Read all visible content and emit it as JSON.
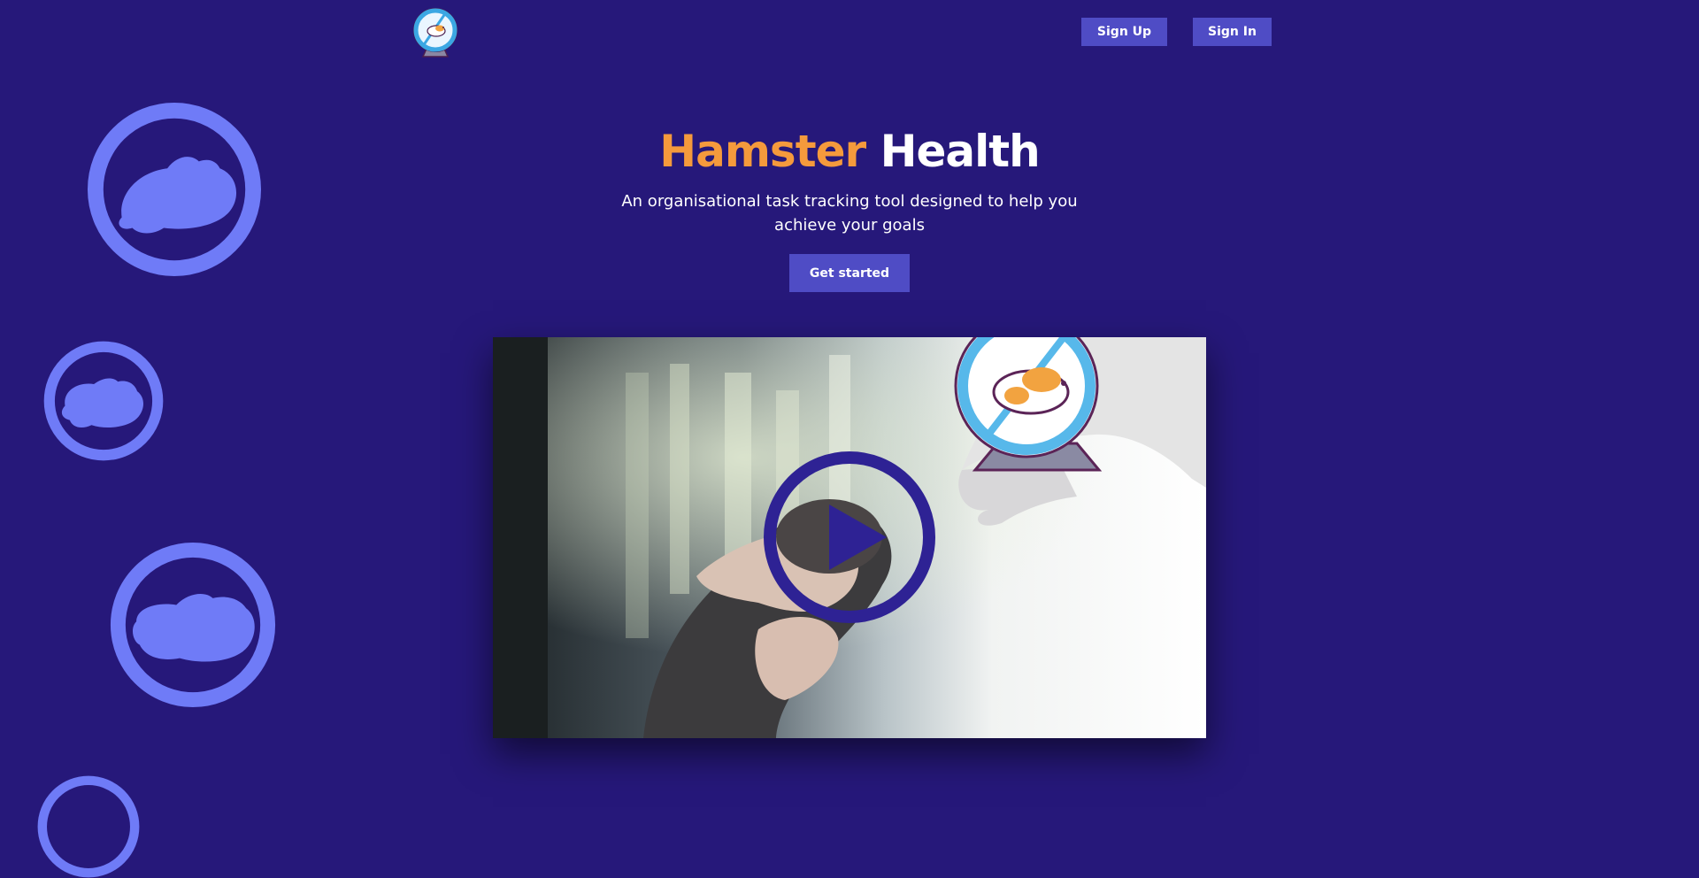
{
  "header": {
    "logo_icon": "hamster-wheel-logo-icon",
    "signup_label": "Sign Up",
    "signin_label": "Sign In"
  },
  "hero": {
    "title_accent": "Hamster",
    "title_rest": "Health",
    "subtitle": "An organisational task tracking tool designed to help you achieve your goals",
    "cta_label": "Get started"
  },
  "video": {
    "play_icon": "play-icon",
    "overlay_icon": "hamster-wheel-icon"
  },
  "decorations": {
    "icon": "hamster-wheel-silhouette-icon",
    "count": 4
  },
  "colors": {
    "background": "#26187a",
    "accent_orange": "#f59a3c",
    "button": "#4f4cc5",
    "decoration": "#6f7bf7",
    "play": "#2e2294"
  }
}
